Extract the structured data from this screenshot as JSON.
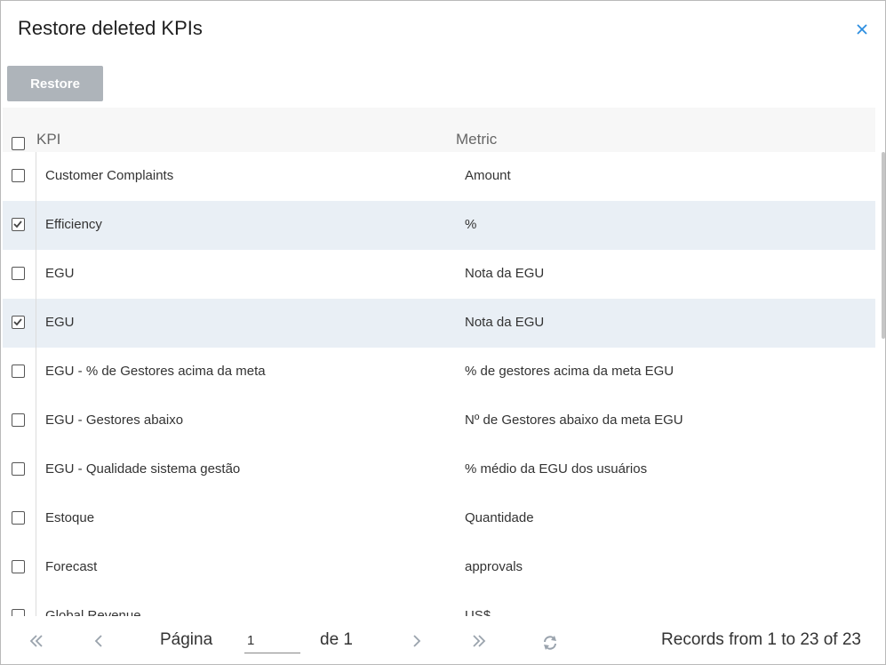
{
  "dialog": {
    "title": "Restore deleted KPIs",
    "close_icon": "close-icon",
    "accent_color": "#2b8de0"
  },
  "toolbar": {
    "restore_label": "Restore",
    "restore_color": "#aeb4ba"
  },
  "grid": {
    "columns": [
      {
        "key": "kpi",
        "label": "KPI"
      },
      {
        "key": "metric",
        "label": "Metric"
      }
    ],
    "rows": [
      {
        "kpi": "Customer Complaints",
        "metric": "Amount",
        "checked": false
      },
      {
        "kpi": "Efficiency",
        "metric": "%",
        "checked": true
      },
      {
        "kpi": "EGU",
        "metric": "Nota da EGU",
        "checked": false
      },
      {
        "kpi": "EGU",
        "metric": "Nota da EGU",
        "checked": true
      },
      {
        "kpi": "EGU - % de Gestores acima da meta",
        "metric": "% de gestores acima da meta EGU",
        "checked": false
      },
      {
        "kpi": "EGU - Gestores abaixo",
        "metric": "Nº de Gestores abaixo da meta EGU",
        "checked": false
      },
      {
        "kpi": "EGU - Qualidade sistema gestão",
        "metric": "% médio da EGU dos usuários",
        "checked": false
      },
      {
        "kpi": "Estoque",
        "metric": "Quantidade",
        "checked": false
      },
      {
        "kpi": "Forecast",
        "metric": "approvals",
        "checked": false
      },
      {
        "kpi": "Global Revenue",
        "metric": "US$",
        "checked": false
      }
    ],
    "selected_row_color": "#e9eff5"
  },
  "pager": {
    "page_label": "Página",
    "page_value": "1",
    "of_label": "de 1",
    "records_label": "Records from 1 to 23 of 23"
  }
}
